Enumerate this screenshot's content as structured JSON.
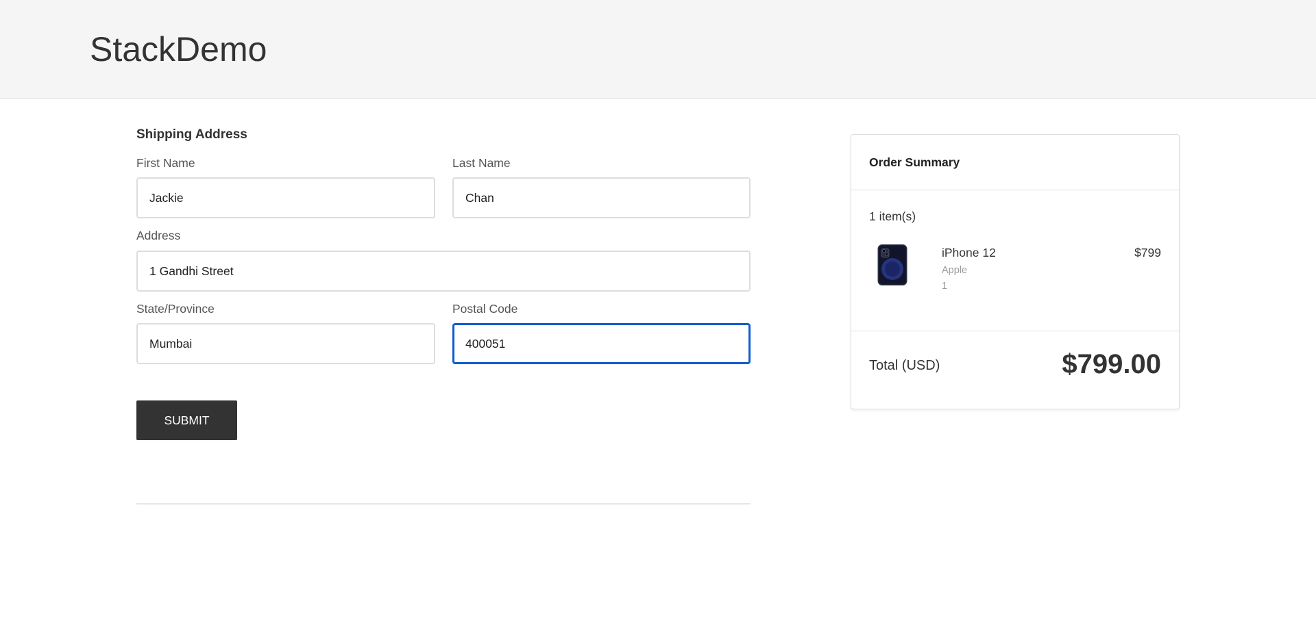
{
  "header": {
    "brand": "StackDemo"
  },
  "shipping": {
    "title": "Shipping Address",
    "first_name": {
      "label": "First Name",
      "value": "Jackie"
    },
    "last_name": {
      "label": "Last Name",
      "value": "Chan"
    },
    "address": {
      "label": "Address",
      "value": "1 Gandhi Street"
    },
    "state": {
      "label": "State/Province",
      "value": "Mumbai"
    },
    "postal_code": {
      "label": "Postal Code",
      "value": "400051"
    },
    "submit_label": "SUBMIT"
  },
  "summary": {
    "title": "Order Summary",
    "items_count": "1 item(s)",
    "items": [
      {
        "name": "iPhone 12",
        "brand": "Apple",
        "quantity": "1",
        "price": "$799",
        "icon": "iphone-product-image"
      }
    ],
    "total_label": "Total (USD)",
    "total_value": "$799.00"
  },
  "colors": {
    "header_bg": "#f5f5f5",
    "button_bg": "#333333",
    "focus_border": "#0d5bd1"
  }
}
